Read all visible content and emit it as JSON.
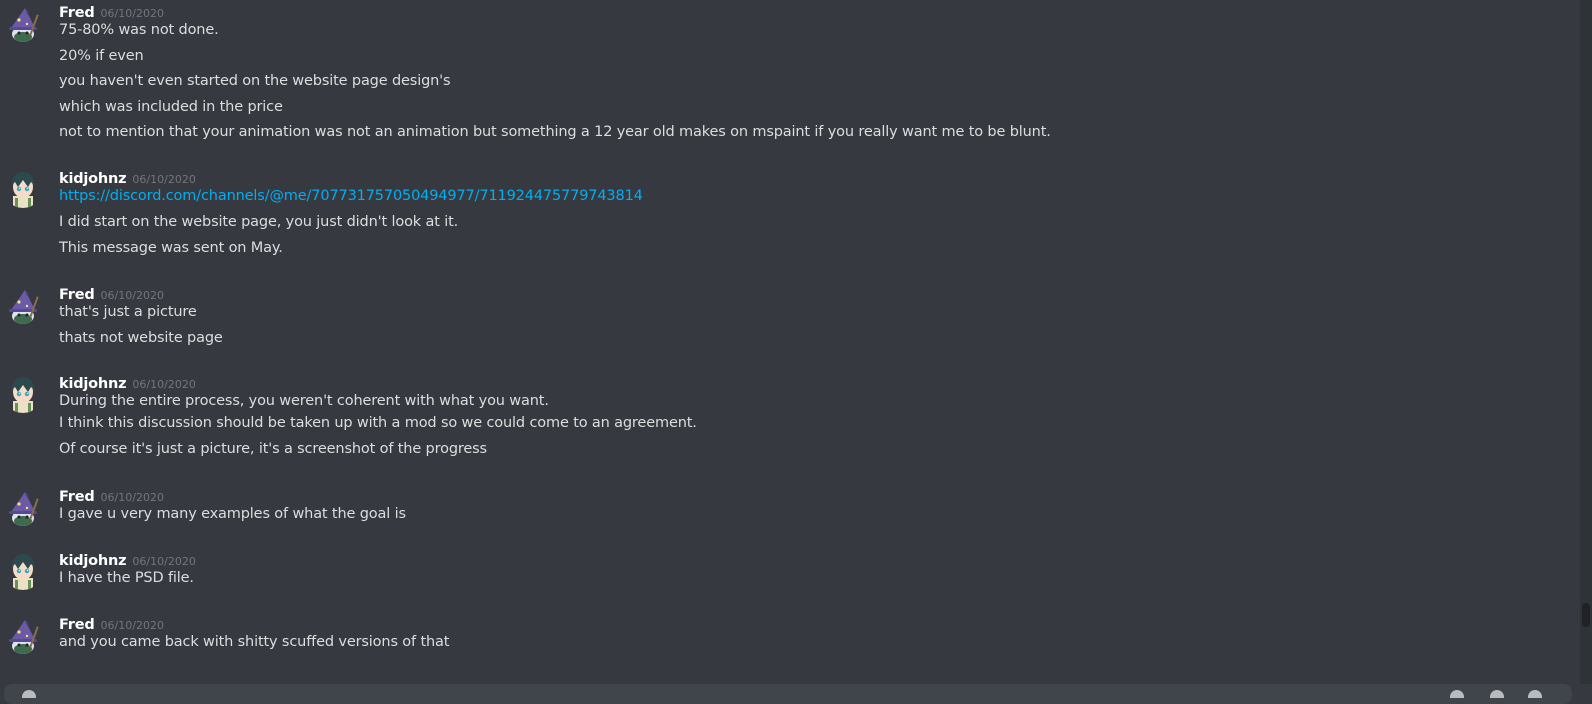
{
  "messages": [
    {
      "author": "Fred",
      "timestamp": "06/10/2020",
      "lines": [
        "75-80% was not done.",
        "20% if even",
        "you haven't even started on the website page design's",
        "which was included in the price",
        "not to mention that your animation was not an animation but something a 12 year old makes on mspaint if you really want me to be blunt."
      ]
    },
    {
      "author": "kidjohnz",
      "timestamp": "06/10/2020",
      "link": "https://discord.com/channels/@me/707731757050494977/711924475779743814",
      "lines": [
        "I did start on the website page, you just didn't look at it.",
        "This message was sent on May."
      ]
    },
    {
      "author": "Fred",
      "timestamp": "06/10/2020",
      "lines": [
        "that's just a picture",
        "thats not website page"
      ]
    },
    {
      "author": "kidjohnz",
      "timestamp": "06/10/2020",
      "lines": [
        "During the entire process, you weren't coherent with what you want.",
        "I think this discussion should be taken up with a mod so we could come to an agreement.",
        "Of course it's just a picture, it's a screenshot of the progress"
      ]
    },
    {
      "author": "Fred",
      "timestamp": "06/10/2020",
      "lines": [
        "I gave u very many examples of what the goal is"
      ]
    },
    {
      "author": "kidjohnz",
      "timestamp": "06/10/2020",
      "lines": [
        "I have the PSD file."
      ]
    },
    {
      "author": "Fred",
      "timestamp": "06/10/2020",
      "lines": [
        "and you came back with shitty scuffed versions of that"
      ]
    }
  ],
  "avatars": {
    "fred_icon": "wizard-avatar-icon",
    "kidjohnz_icon": "anime-avatar-icon"
  },
  "colors": {
    "background": "#36393f",
    "author": "#ffffff",
    "text": "#dcddde",
    "timestamp": "#72767d",
    "link": "#00aff4"
  }
}
